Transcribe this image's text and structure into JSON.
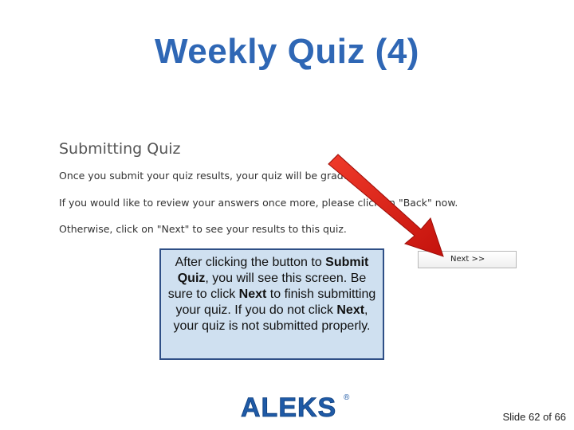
{
  "slide": {
    "title": "Weekly Quiz (4)",
    "number_text": "Slide 62 of 66"
  },
  "screenshot": {
    "heading": "Submitting Quiz",
    "line1": "Once you submit your quiz results, your quiz will be graded.",
    "line2": "If you would like to review your answers once more, please click on \"Back\" now.",
    "line3": "Otherwise, click on \"Next\" to see your results to this quiz.",
    "next_button": "Next >>"
  },
  "callout": {
    "p1": "After clicking the button to ",
    "b1": "Submit Quiz",
    "p2": ", you will see this screen. Be sure to click ",
    "b2": "Next",
    "p3": " to finish submitting your quiz. If you do not click ",
    "b3": "Next",
    "p4": ", your quiz is not submitted properly."
  },
  "logo": {
    "text": "ALEKS",
    "mark": "®"
  },
  "colors": {
    "title": "#2f67b5",
    "callout_bg": "#cfe0f0",
    "callout_border": "#2f4f86",
    "arrow": "#e01a12",
    "logo": "#1f5aa6"
  }
}
